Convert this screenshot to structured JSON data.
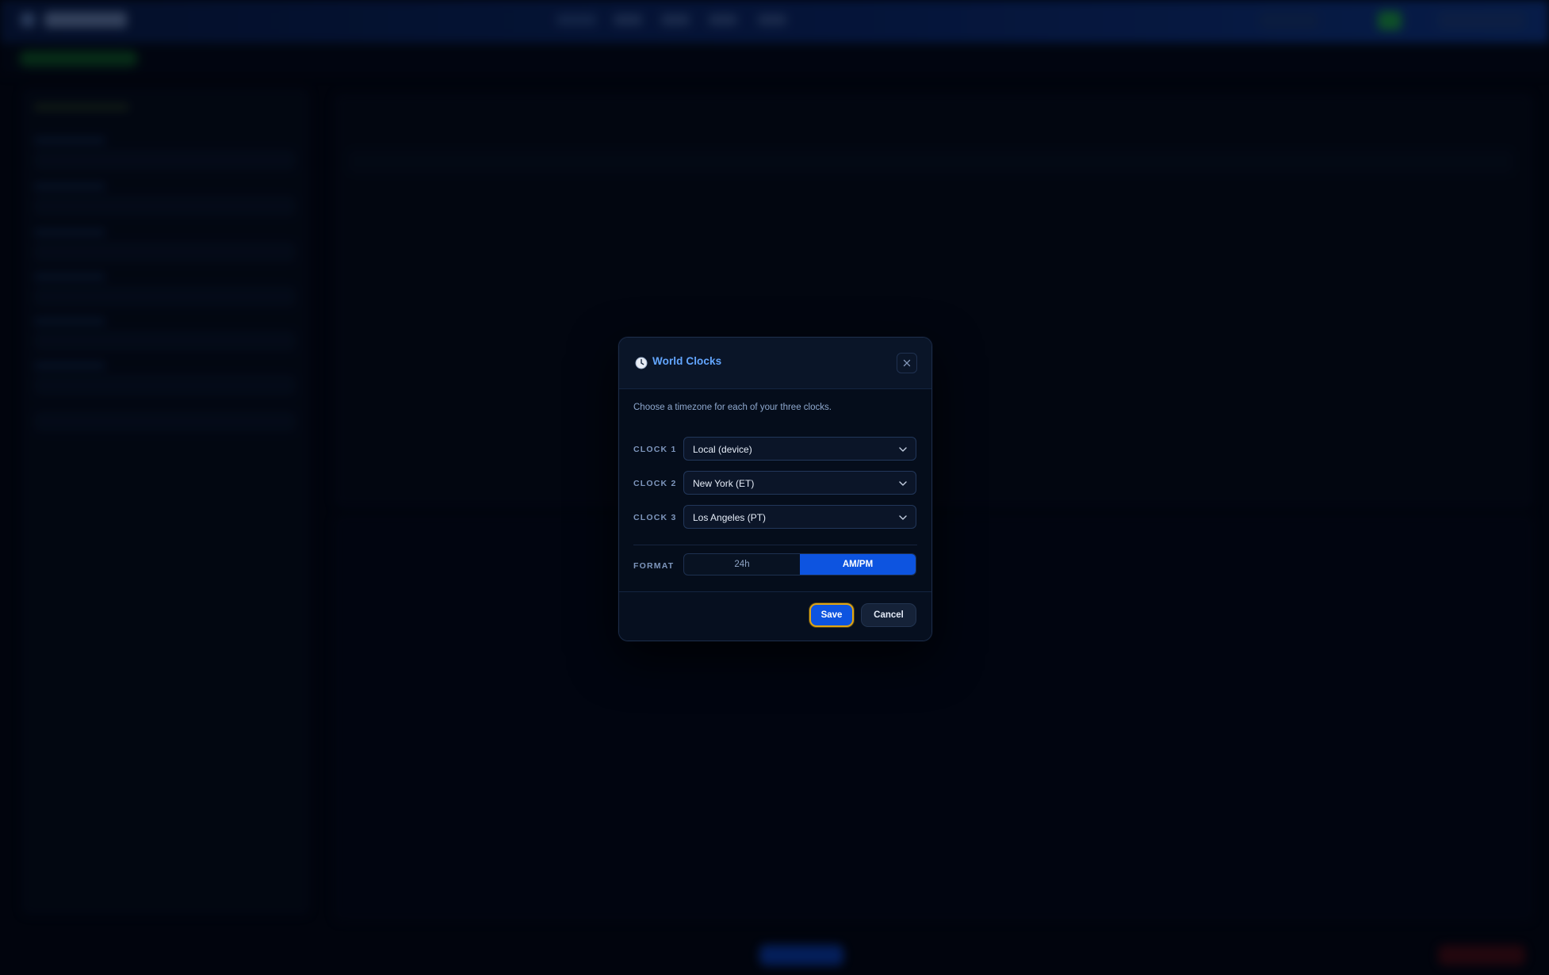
{
  "dialog": {
    "title": "World Clocks",
    "description": "Choose a timezone for each of your three clocks.",
    "icons": {
      "title": "clock-icon",
      "close": "close-icon",
      "dropdown": "chevron-down-icon"
    },
    "clocks": [
      {
        "label": "CLOCK 1",
        "value": "Local (device)"
      },
      {
        "label": "CLOCK 2",
        "value": "New York (ET)"
      },
      {
        "label": "CLOCK 3",
        "value": "Los Angeles (PT)"
      }
    ],
    "format": {
      "label": "FORMAT",
      "options": [
        "24h",
        "AM/PM"
      ],
      "selected": "AM/PM"
    },
    "buttons": {
      "save": "Save",
      "cancel": "Cancel"
    }
  },
  "colors": {
    "accent": "#0d54e0",
    "title": "#63a6ff",
    "focus_ring": "#e0a512",
    "panel": "#050d1b"
  }
}
